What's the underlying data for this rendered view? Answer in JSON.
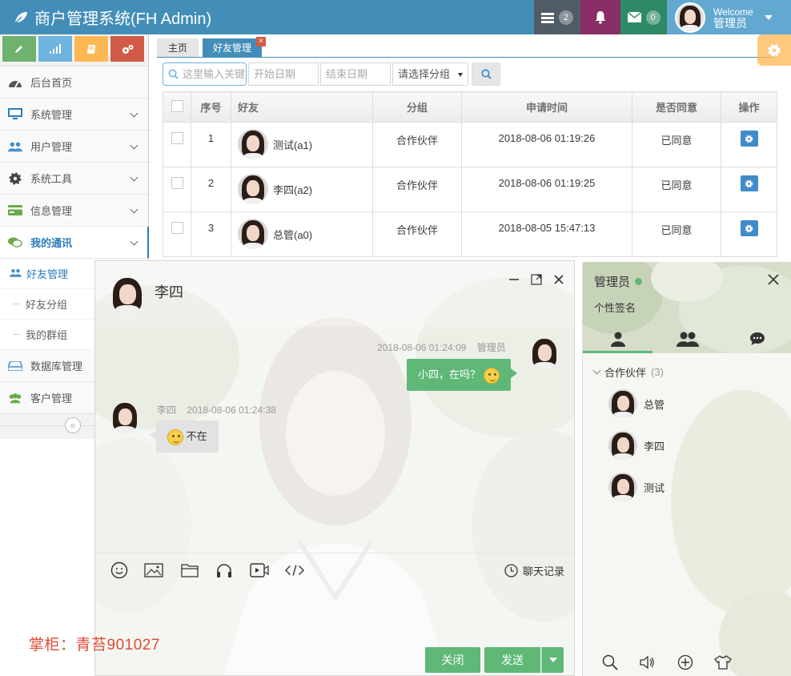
{
  "navbar": {
    "brand": "商户管理系统(FH Admin)",
    "tasks_count": "2",
    "mail_count": "0",
    "welcome": "Welcome",
    "username": "管理员",
    "colors": {
      "bar": "#438eb9",
      "tasks": "#4f5b66",
      "bell": "#892e65",
      "mail": "#2e8965",
      "user": "#62a8d1"
    }
  },
  "sidebar": {
    "shortcuts": [
      {
        "icon": "pencil-icon",
        "color": "#6fb16f"
      },
      {
        "icon": "signal-icon",
        "color": "#6fb3e0"
      },
      {
        "icon": "book-icon",
        "color": "#ffb752"
      },
      {
        "icon": "cogs-icon",
        "color": "#d15b47"
      }
    ],
    "items": [
      {
        "label": "后台首页",
        "icon": "dashboard-icon"
      },
      {
        "label": "系统管理",
        "icon": "desktop-icon"
      },
      {
        "label": "用户管理",
        "icon": "users-icon"
      },
      {
        "label": "系统工具",
        "icon": "gear-icon"
      },
      {
        "label": "信息管理",
        "icon": "credit-card-icon"
      },
      {
        "label": "我的通讯",
        "icon": "comments-icon"
      }
    ],
    "sub_items": [
      {
        "label": "好友管理",
        "icon": "users-icon"
      },
      {
        "label": "好友分组"
      },
      {
        "label": "我的群组"
      }
    ],
    "items_after": [
      {
        "label": "数据库管理",
        "icon": "hdd-icon"
      },
      {
        "label": "客户管理",
        "icon": "group-icon"
      }
    ]
  },
  "tabs": [
    {
      "label": "主页"
    },
    {
      "label": "好友管理",
      "close": "×"
    }
  ],
  "search": {
    "keyword_placeholder": "这里输入关键",
    "start_placeholder": "开始日期",
    "end_placeholder": "结束日期",
    "group_select": "请选择分组"
  },
  "table": {
    "headers": [
      "序号",
      "好友",
      "分组",
      "申请时间",
      "是否同意",
      "操作"
    ],
    "rows": [
      {
        "index": "1",
        "friend": "测试(a1)",
        "group": "合作伙伴",
        "time": "2018-08-06 01:19:26",
        "agree": "已同意"
      },
      {
        "index": "2",
        "friend": "李四(a2)",
        "group": "合作伙伴",
        "time": "2018-08-06 01:19:25",
        "agree": "已同意"
      },
      {
        "index": "3",
        "friend": "总管(a0)",
        "group": "合作伙伴",
        "time": "2018-08-05 15:47:13",
        "agree": "已同意"
      }
    ]
  },
  "chat": {
    "title": "李四",
    "messages": [
      {
        "who": "me",
        "time": "2018-08-06 01:24:09",
        "name": "管理员",
        "text": "小四，在吗？"
      },
      {
        "who": "other",
        "name": "李四",
        "time": "2018-08-06 01:24:38",
        "text": "不在"
      }
    ],
    "history": "聊天记录",
    "close_label": "关闭",
    "send_label": "发送",
    "accent": "#5fb878"
  },
  "watermark": "掌柜：青苔901027",
  "panel": {
    "name": "管理员",
    "signature": "个性签名",
    "group": {
      "name": "合作伙伴",
      "count": "(3)"
    },
    "contacts": [
      "总管",
      "李四",
      "测试"
    ]
  }
}
